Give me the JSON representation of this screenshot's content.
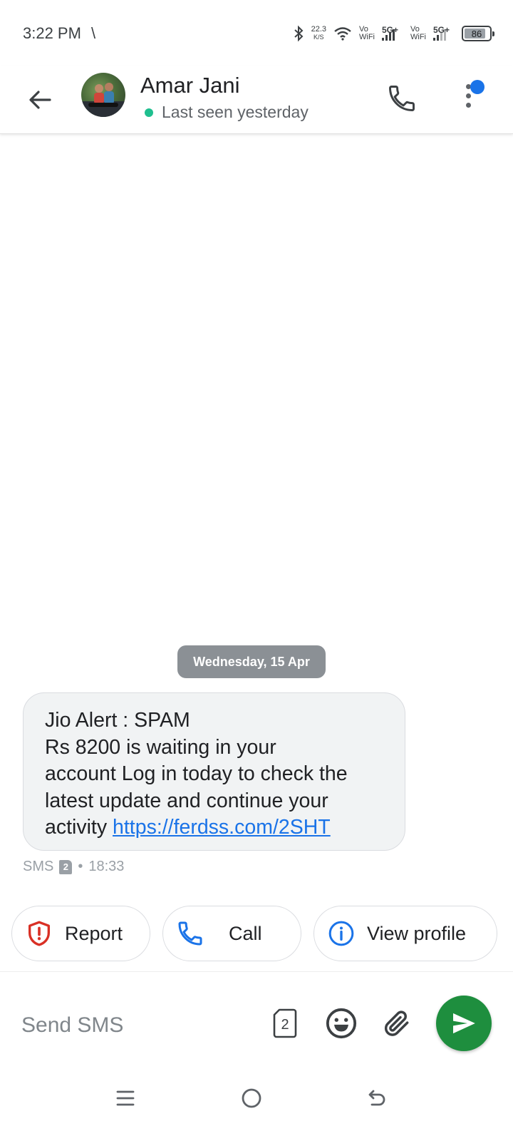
{
  "status_bar": {
    "time": "3:22 PM",
    "extra_glyph": "\\",
    "net_speed_value": "22.3",
    "net_speed_unit": "K/S",
    "vowifi_top": "Vo",
    "vowifi_bottom": "WiFi",
    "network_type": "5G+",
    "battery_level": "86",
    "icons": [
      "bluetooth-icon",
      "wifi-icon",
      "signal-icon",
      "battery-icon"
    ]
  },
  "header": {
    "contact_name": "Amar Jani",
    "presence": "Last seen yesterday",
    "presence_color": "#1fbf8f",
    "badge_color": "#1a73e8"
  },
  "chat": {
    "date_chip": "Wednesday, 15 Apr",
    "message": {
      "lines": [
        "Jio Alert : SPAM",
        "Rs 8200 is waiting in your",
        "account Log in today to check the",
        "latest update and continue your"
      ],
      "last_line_prefix": "activity",
      "link": "https://ferdss.com/2SHT"
    },
    "meta": {
      "type": "SMS",
      "sim": "2",
      "separator": "•",
      "time": "18:33"
    }
  },
  "suggestions": [
    {
      "label": "Report",
      "icon": "shield-alert-icon"
    },
    {
      "label": "Call",
      "icon": "phone-icon"
    },
    {
      "label": "View profile",
      "icon": "info-icon"
    }
  ],
  "compose": {
    "placeholder": "Send SMS",
    "value": "",
    "sim_label": "2",
    "send_color": "#1e8e3e"
  }
}
